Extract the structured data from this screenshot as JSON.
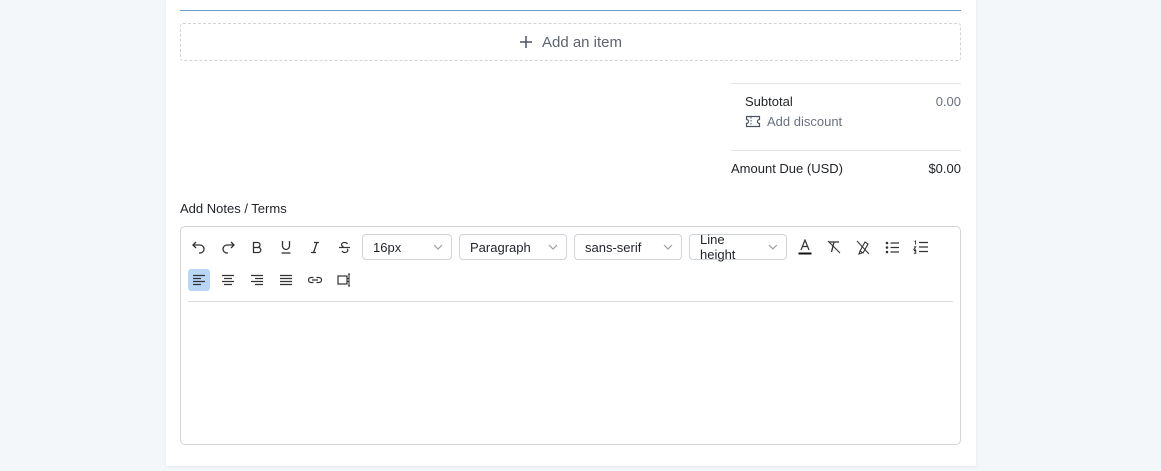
{
  "items": {
    "add_label": "Add an item"
  },
  "totals": {
    "subtotal_label": "Subtotal",
    "subtotal_value": "0.00",
    "add_discount_label": "Add discount",
    "amount_due_label": "Amount Due (USD)",
    "amount_due_value": "$0.00"
  },
  "notes": {
    "label": "Add Notes / Terms",
    "toolbar": {
      "font_size": "16px",
      "block_type": "Paragraph",
      "font_family": "sans-serif",
      "line_height": "Line height"
    },
    "content": ""
  },
  "icons": [
    "plus-icon",
    "ticket-icon",
    "undo-icon",
    "redo-icon",
    "bold-icon",
    "underline-icon",
    "italic-icon",
    "strikethrough-icon",
    "chevron-down-icon",
    "font-color-icon",
    "clear-format-icon",
    "highlight-icon",
    "bullet-list-icon",
    "numbered-list-icon",
    "align-left-icon",
    "align-center-icon",
    "align-right-icon",
    "align-justify-icon",
    "link-icon",
    "media-icon"
  ],
  "colors": {
    "accent_line": "#6d9cc7",
    "active_button": "#b9d6f7",
    "background": "#f3f7fa"
  }
}
